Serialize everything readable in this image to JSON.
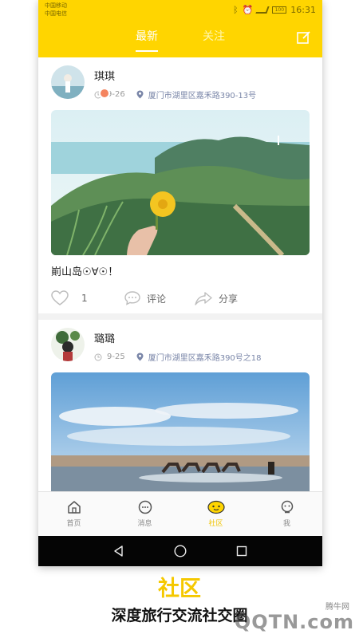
{
  "status_bar": {
    "carrier_1": "中国移动",
    "carrier_2": "中国电信",
    "battery": "100",
    "time": "16:31"
  },
  "header": {
    "tabs": [
      {
        "label": "最新",
        "active": true
      },
      {
        "label": "关注",
        "active": false
      }
    ],
    "edit_icon": "edit-icon"
  },
  "posts": [
    {
      "username": "琪琪",
      "date": "9-26",
      "location": "厦门市湖里区嘉禾路390-13号",
      "caption": "崱山岛☉∀☉！",
      "likes": "1",
      "comment_label": "评论",
      "share_label": "分享"
    },
    {
      "username": "璐璐",
      "date": "9-25",
      "location": "厦门市湖里区嘉禾路390号之18"
    }
  ],
  "tab_bar": {
    "items": [
      {
        "label": "首页",
        "icon": "home-icon",
        "active": false
      },
      {
        "label": "消息",
        "icon": "message-icon",
        "active": false
      },
      {
        "label": "社区",
        "icon": "community-icon",
        "active": true
      },
      {
        "label": "我",
        "icon": "profile-icon",
        "active": false
      }
    ]
  },
  "promo": {
    "title": "社区",
    "subtitle": "深度旅行交流社交圈"
  },
  "watermark": {
    "text": "腾牛网",
    "logo": "QQTN.com"
  },
  "colors": {
    "accent": "#ffd500",
    "active_tab": "#f0c400",
    "location": "#7a86a8"
  }
}
